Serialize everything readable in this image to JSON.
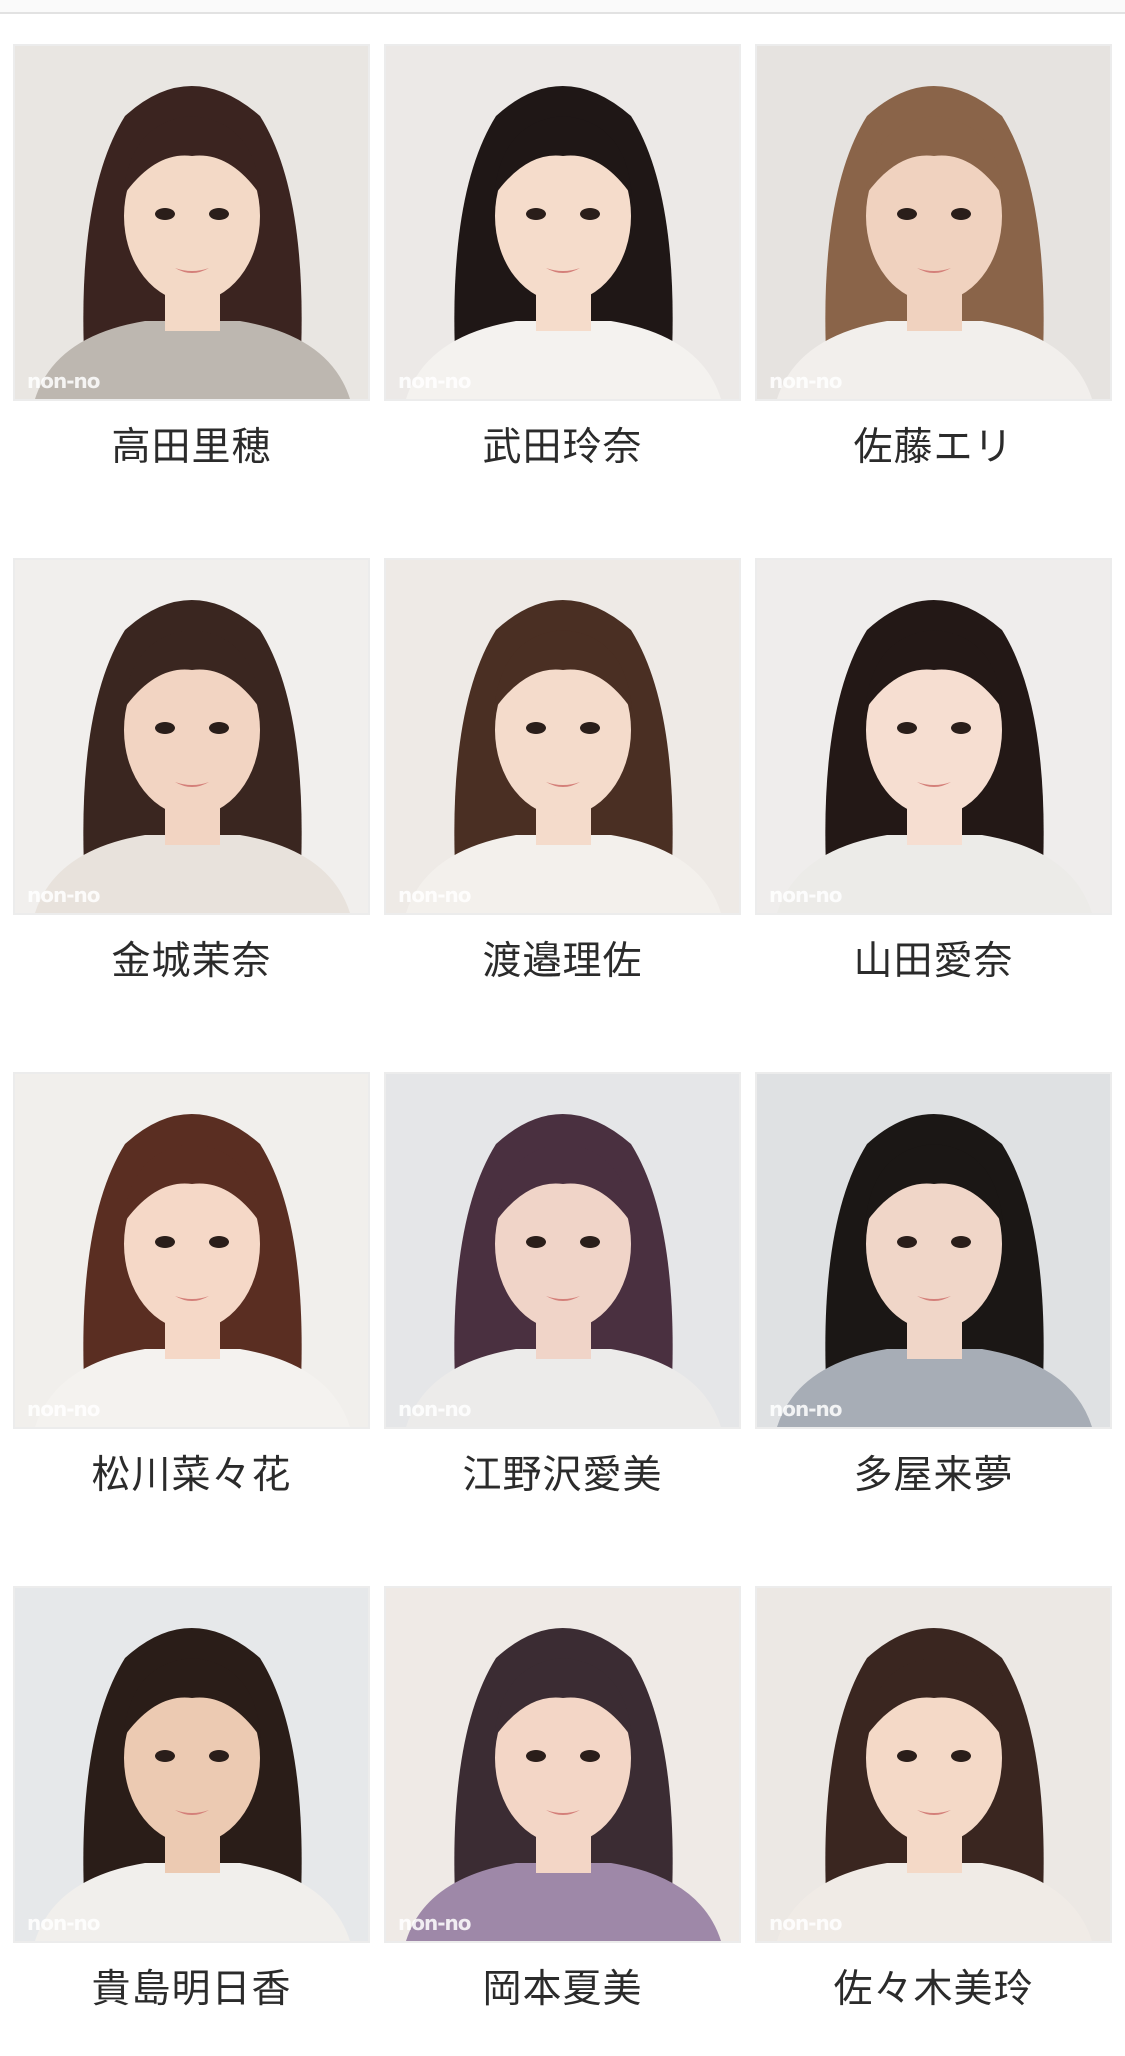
{
  "watermark": "non-no",
  "models": [
    {
      "name": "高田里穂",
      "bg": "#e9e6e2",
      "hair": "#3b2420",
      "skin": "#f3d9c6",
      "top": "#bdb7b0"
    },
    {
      "name": "武田玲奈",
      "bg": "#ece9e7",
      "hair": "#1f1716",
      "skin": "#f5dccb",
      "top": "#f4f2ef"
    },
    {
      "name": "佐藤エリ",
      "bg": "#e6e3e0",
      "hair": "#8a6449",
      "skin": "#f0d2bf",
      "top": "#f2efec"
    },
    {
      "name": "金城茉奈",
      "bg": "#f1efed",
      "hair": "#3a2620",
      "skin": "#f2d4c2",
      "top": "#e8e2dc"
    },
    {
      "name": "渡邉理佐",
      "bg": "#eeeae6",
      "hair": "#4a2f23",
      "skin": "#f4dbcb",
      "top": "#f3f0ec"
    },
    {
      "name": "山田愛奈",
      "bg": "#efedec",
      "hair": "#231816",
      "skin": "#f6ded1",
      "top": "#ecebe8"
    },
    {
      "name": "松川菜々花",
      "bg": "#f1efec",
      "hair": "#5a2e22",
      "skin": "#f5d8c7",
      "top": "#f4f2ef"
    },
    {
      "name": "江野沢愛美",
      "bg": "#e5e6e8",
      "hair": "#4a3040",
      "skin": "#f0d4c8",
      "top": "#ecebea"
    },
    {
      "name": "多屋来夢",
      "bg": "#dfe1e3",
      "hair": "#1b1715",
      "skin": "#f0d6c8",
      "top": "#a7adb6"
    },
    {
      "name": "貴島明日香",
      "bg": "#e6e8ea",
      "hair": "#2a1d18",
      "skin": "#eccab2",
      "top": "#f1efec"
    },
    {
      "name": "岡本夏美",
      "bg": "#efeae6",
      "hair": "#3b2c33",
      "skin": "#f3d6c6",
      "top": "#9e88a8"
    },
    {
      "name": "佐々木美玲",
      "bg": "#ece8e4",
      "hair": "#3a2620",
      "skin": "#f4d9c7",
      "top": "#f0ebe6"
    }
  ]
}
